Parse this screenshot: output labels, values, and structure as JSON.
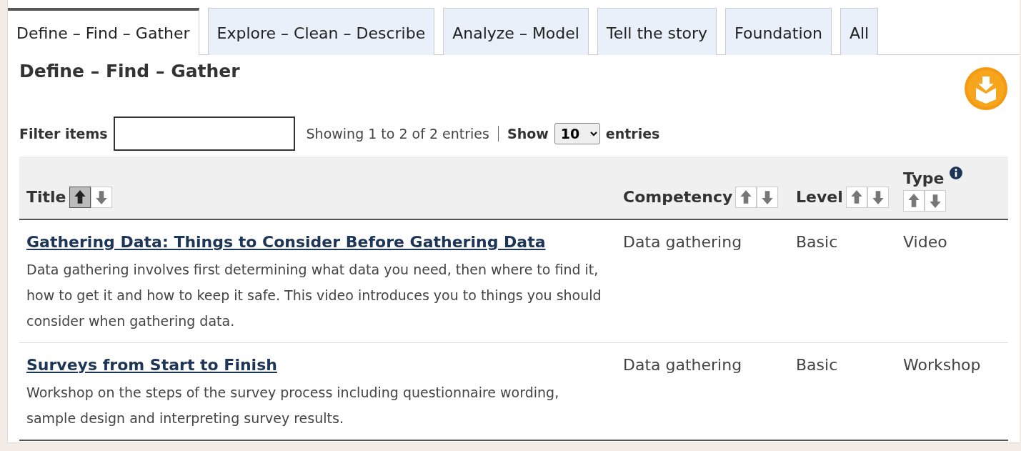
{
  "tabs": [
    {
      "label": "Define – Find – Gather",
      "selected": true
    },
    {
      "label": "Explore – Clean – Describe",
      "selected": false
    },
    {
      "label": "Analyze – Model",
      "selected": false
    },
    {
      "label": "Tell the story",
      "selected": false
    },
    {
      "label": "Foundation",
      "selected": false
    },
    {
      "label": "All",
      "selected": false
    }
  ],
  "heading": "Define – Find – Gather",
  "filter": {
    "label": "Filter items"
  },
  "summary": "Showing 1 to 2 of 2 entries",
  "page_size": {
    "before": "Show",
    "value": "10",
    "after": "entries"
  },
  "table": {
    "columns": [
      {
        "label": "Title",
        "info": false,
        "sort": [
          {
            "selected": true
          },
          {
            "selected": false
          }
        ]
      },
      {
        "label": "Competency",
        "info": false,
        "sort": [
          {
            "selected": false
          },
          {
            "selected": false
          }
        ]
      },
      {
        "label": "Level",
        "info": false,
        "sort": [
          {
            "selected": false
          },
          {
            "selected": false
          }
        ]
      },
      {
        "label": "Type",
        "info": true,
        "sort": [
          {
            "selected": false
          },
          {
            "selected": false
          }
        ]
      }
    ],
    "rows": [
      {
        "title": "Gathering Data: Things to Consider Before Gathering Data",
        "description": "Data gathering involves first determining what data you need, then where to find it, how to get it and how to keep it safe. This video introduces you to things you should consider when gathering data.",
        "competency": "Data gathering",
        "level": "Basic",
        "type": "Video"
      },
      {
        "title": "Surveys from Start to Finish",
        "description": "Workshop on the steps of the survey process including questionnaire wording, sample design and interpreting survey results.",
        "competency": "Data gathering",
        "level": "Basic",
        "type": "Workshop"
      }
    ]
  }
}
